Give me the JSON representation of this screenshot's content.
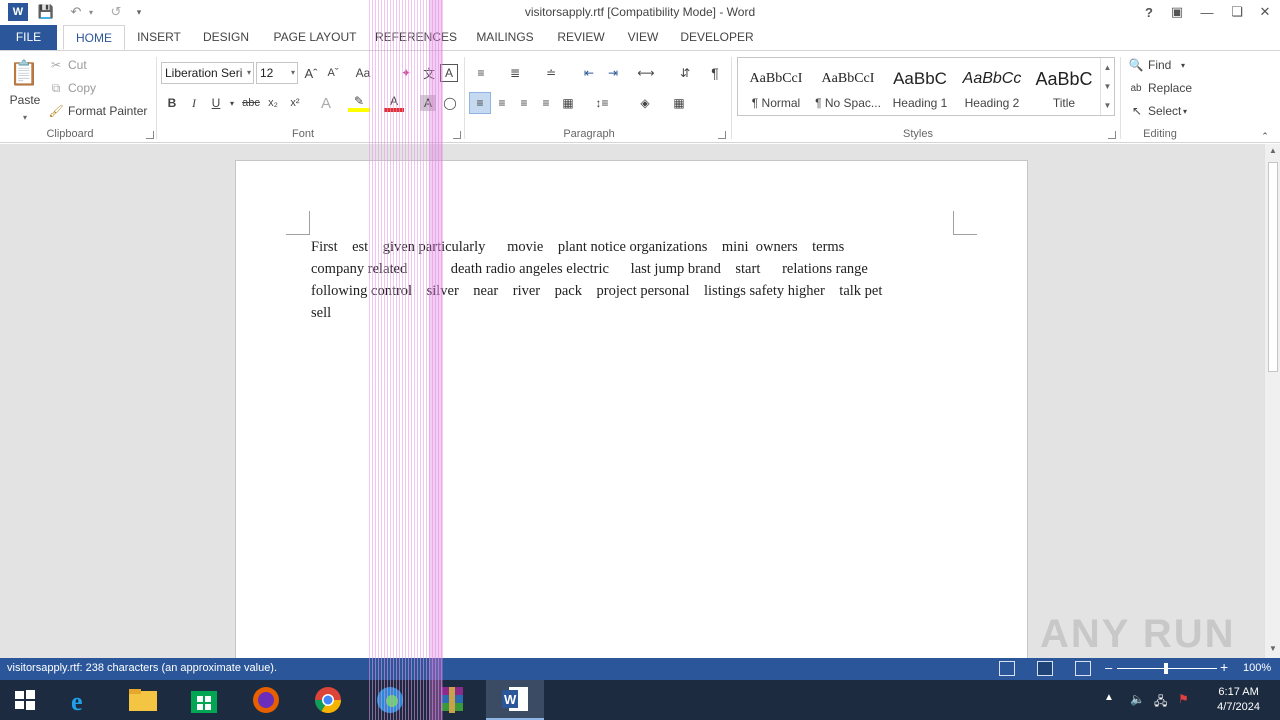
{
  "window": {
    "title": "visitorsapply.rtf [Compatibility Mode] - Word"
  },
  "tabs": [
    "FILE",
    "HOME",
    "INSERT",
    "DESIGN",
    "PAGE LAYOUT",
    "REFERENCES",
    "MAILINGS",
    "REVIEW",
    "VIEW",
    "DEVELOPER"
  ],
  "clipboard": {
    "paste": "Paste",
    "cut": "Cut",
    "copy": "Copy",
    "format_painter": "Format Painter",
    "label": "Clipboard"
  },
  "font": {
    "name": "Liberation Seri",
    "size": "12",
    "label": "Font",
    "case": "Aa",
    "bold": "B",
    "italic": "I",
    "underline": "U",
    "strike": "abc",
    "subscript": "x₂",
    "superscript": "x²"
  },
  "paragraph": {
    "label": "Paragraph"
  },
  "styles": {
    "label": "Styles",
    "items": [
      {
        "preview": "AaBbCcI",
        "name": "¶ Normal"
      },
      {
        "preview": "AaBbCcI",
        "name": "¶ No Spac..."
      },
      {
        "preview": "AaBbC",
        "name": "Heading 1"
      },
      {
        "preview": "AaBbCc",
        "name": "Heading 2"
      },
      {
        "preview": "AaBbC",
        "name": "Title"
      }
    ]
  },
  "editing": {
    "find": "Find",
    "replace": "Replace",
    "select": "Select",
    "label": "Editing"
  },
  "document": {
    "lines": [
      "First    est    given particularly      movie    plant notice organizations    mini  owners    terms",
      "company related            death radio angeles electric      last jump brand    start      relations range",
      "following control    silver    near    river    pack    project personal    listings safety higher    talk pet",
      "sell"
    ]
  },
  "status": {
    "text": "visitorsapply.rtf: 238 characters (an approximate value).",
    "zoom": "100%"
  },
  "taskbar": {
    "time": "6:17 AM",
    "date": "4/7/2024"
  },
  "watermark": "ANY RUN"
}
